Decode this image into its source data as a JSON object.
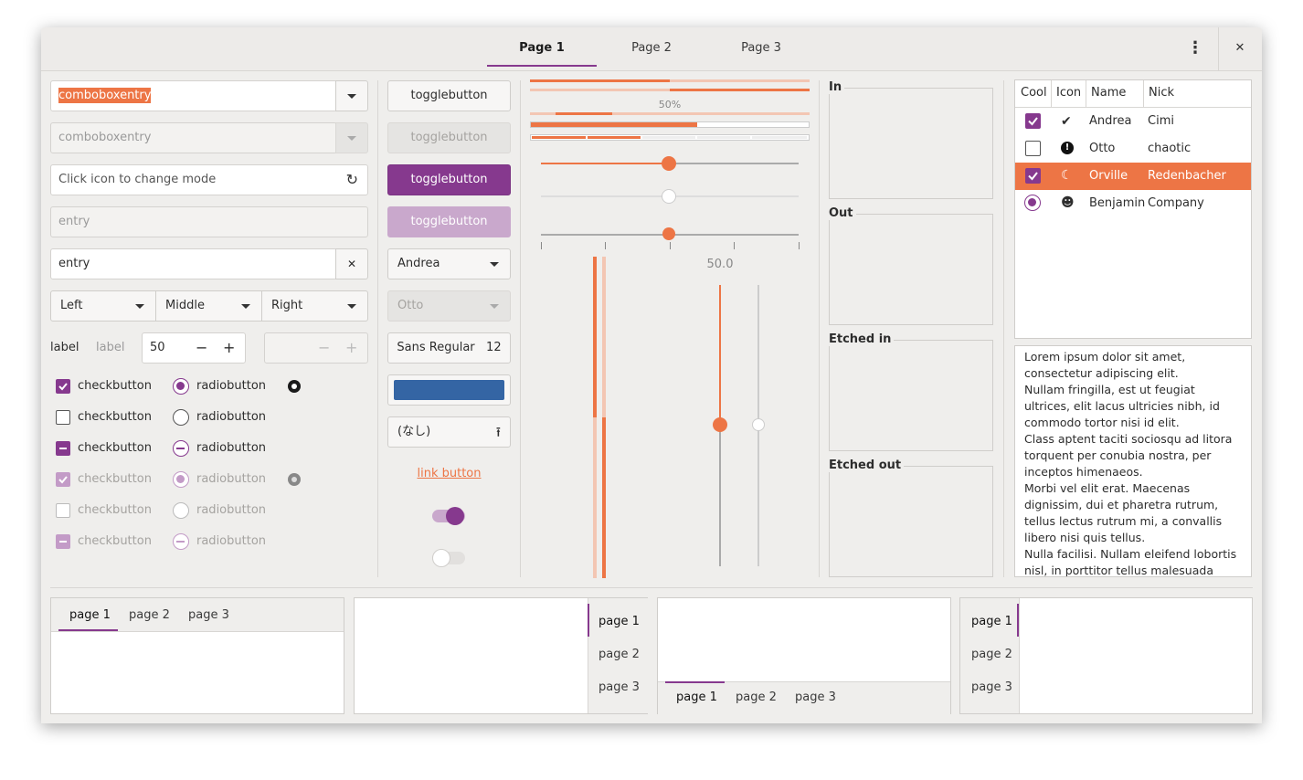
{
  "header": {
    "tabs": [
      "Page 1",
      "Page 2",
      "Page 3"
    ],
    "menu_icon": "vertical-dots-icon",
    "close_icon": "close-icon",
    "glyphs": {
      "menu": "⋮",
      "close": "✕"
    }
  },
  "col1": {
    "combo1": "comboboxentry",
    "combo2": "comboboxentry",
    "entry_mode_placeholder": "Click icon to change mode",
    "entry_disabled": "entry",
    "entry_clear": "entry",
    "segmented": [
      "Left",
      "Middle",
      "Right"
    ],
    "spin_label": "label",
    "spin_label_dim": "label",
    "spin_value": "50",
    "spin_minus": "−",
    "spin_plus": "+",
    "check_label": "checkbutton",
    "radio_label": "radiobutton",
    "clear_glyph": "✕",
    "refresh_glyph": "↻"
  },
  "col2": {
    "toggle": "togglebutton",
    "combo_andrea": "Andrea",
    "combo_otto": "Otto",
    "font_name": "Sans Regular",
    "font_size": "12",
    "color": "#3465a4",
    "file_label": "(なし)",
    "upload_glyph": "⭱",
    "link": "link button"
  },
  "col3": {
    "progress_label": "50%",
    "scale_value": "50.0",
    "progress_fraction": 0.5
  },
  "frames": [
    "In",
    "Out",
    "Etched in",
    "Etched out"
  ],
  "tree": {
    "headers": [
      "Cool",
      "Icon",
      "Name",
      "Nick"
    ],
    "rows": [
      {
        "cool": "check",
        "icon": "✔",
        "name": "Andrea",
        "nick": "Cimi",
        "selected": false
      },
      {
        "cool": "empty",
        "icon": "!",
        "name": "Otto",
        "nick": "chaotic",
        "selected": false
      },
      {
        "cool": "check",
        "icon": "☾",
        "name": "Orville",
        "nick": "Redenbacher",
        "selected": true
      },
      {
        "cool": "radio",
        "icon": "☻",
        "name": "Benjamin",
        "nick": "Company",
        "selected": false
      }
    ]
  },
  "textview": [
    "Lorem ipsum dolor sit amet,",
    "consectetur adipiscing elit.",
    "Nullam fringilla, est ut feugiat",
    "ultrices, elit lacus ultricies nibh, id",
    "commodo tortor nisi id elit.",
    "Class aptent taciti sociosqu ad litora",
    "torquent per conubia nostra, per",
    "inceptos himenaeos.",
    "Morbi vel elit erat. Maecenas",
    "dignissim, dui et pharetra rutrum,",
    "tellus lectus rutrum mi, a convallis",
    "libero nisi quis tellus.",
    "Nulla facilisi. Nullam eleifend lobortis",
    "nisl, in porttitor tellus malesuada"
  ],
  "notebooks": {
    "tabs": [
      "page 1",
      "page 2",
      "page 3"
    ]
  },
  "colors": {
    "accent": "#86398e",
    "orange": "#ed7545",
    "selected_row": "#ed7545"
  }
}
